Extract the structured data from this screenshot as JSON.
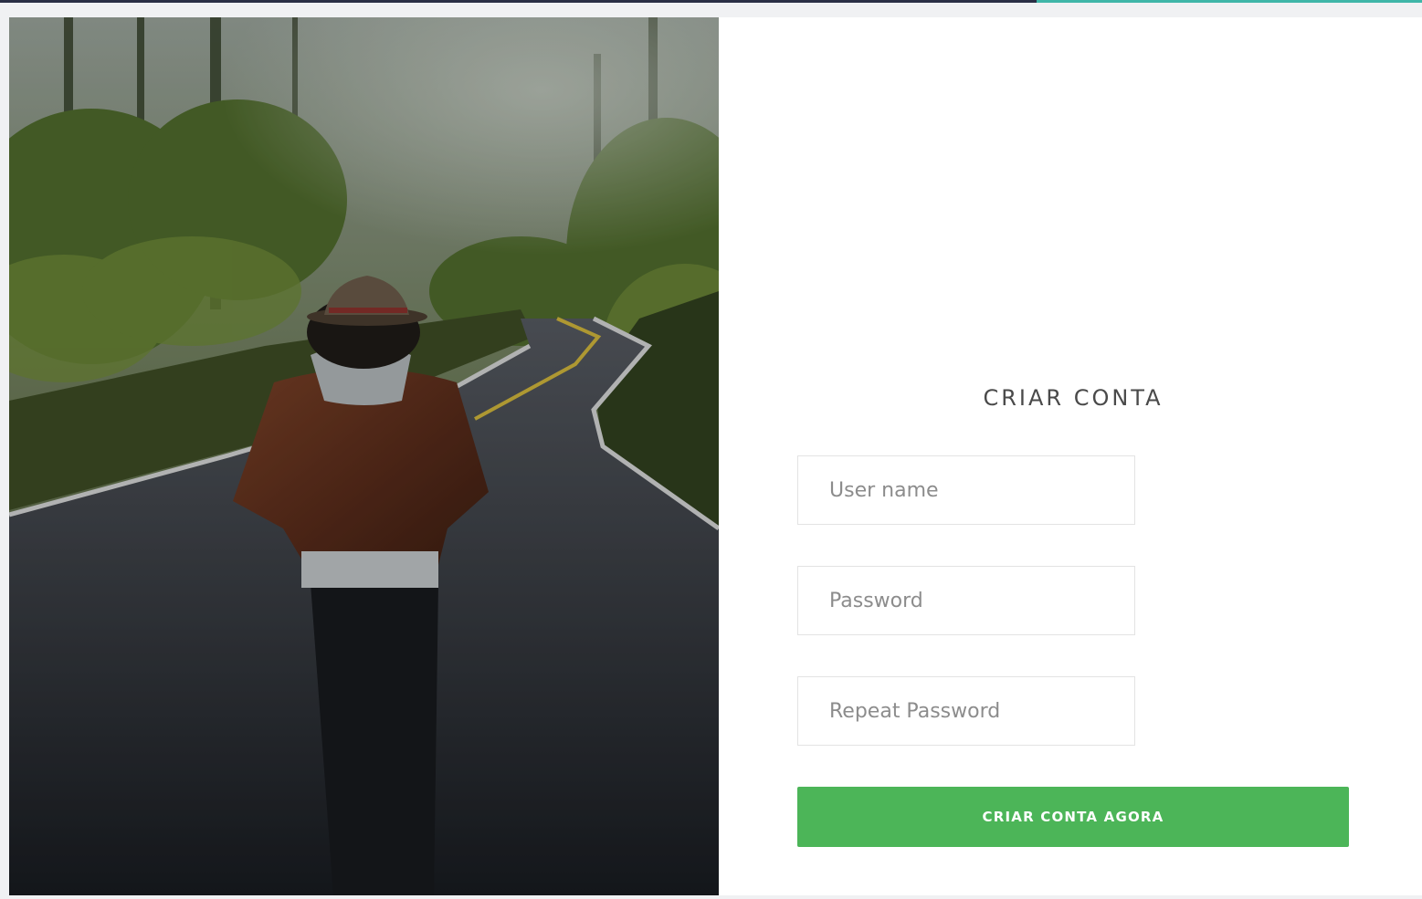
{
  "form": {
    "title": "CRIAR CONTA",
    "username_placeholder": "User name",
    "password_placeholder": "Password",
    "repeat_password_placeholder": "Repeat Password",
    "submit_label": "CRIAR CONTA AGORA"
  },
  "colors": {
    "accent_green": "#4cb558",
    "top_bar": "#2a2f45",
    "top_accent": "#3fb6a8"
  },
  "photo": {
    "subject": "hiker-on-forest-road"
  }
}
